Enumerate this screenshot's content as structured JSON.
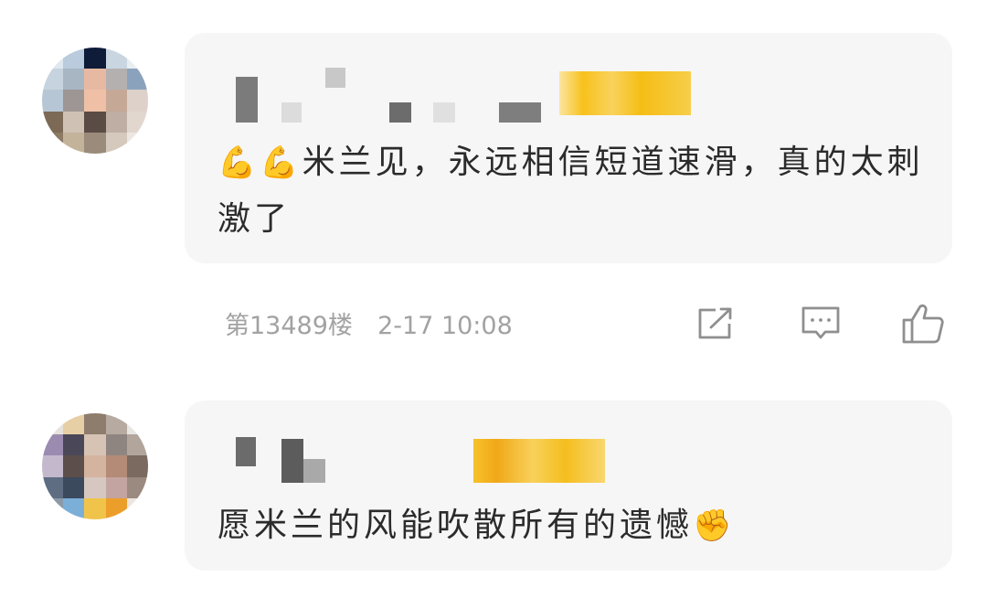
{
  "comments": [
    {
      "text": "米兰见，永远相信短道速滑，真的太刺激了",
      "emoji": "💪💪",
      "floor": "第13489楼",
      "time": "2-17 10:08"
    },
    {
      "text": "愿米兰的风能吹散所有的遗憾",
      "emoji": "✊"
    }
  ],
  "actions": {
    "share_icon": "share-icon",
    "reply_icon": "comment-icon",
    "like_icon": "thumbs-up-icon"
  },
  "colors": {
    "bubble": "#f6f6f6",
    "text": "#2b2b2b",
    "meta": "#a2a2a2",
    "badge": "#f6c21a"
  }
}
